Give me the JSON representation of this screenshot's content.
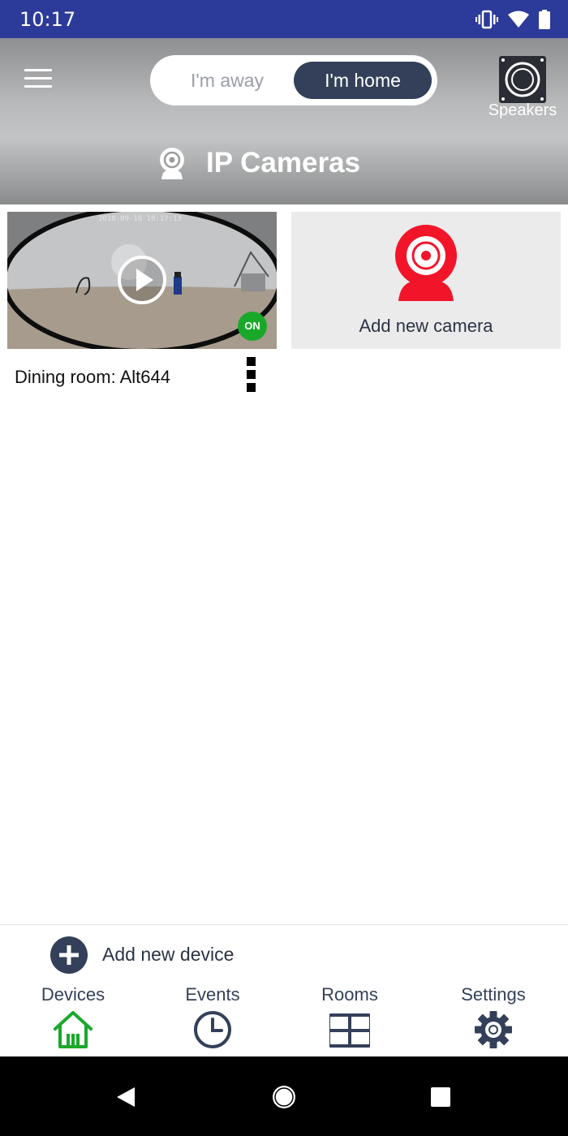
{
  "status_bar": {
    "time": "10:17",
    "icons": [
      "vibrate-icon",
      "wifi-icon",
      "battery-icon"
    ],
    "background": "#2c3a9a"
  },
  "header": {
    "mode_toggle": {
      "away_label": "I'm away",
      "home_label": "I'm home",
      "selected": "home"
    },
    "speakers_label": "Speakers",
    "title": "IP Cameras"
  },
  "cameras": [
    {
      "name": "Dining room: Alt644",
      "timestamp": "2018-09-16 10:17:13",
      "status": "ON"
    }
  ],
  "add_camera": {
    "label": "Add new camera",
    "icon": "webcam-icon",
    "accent": "#f2152a"
  },
  "add_device": {
    "label": "Add new device"
  },
  "bottom_nav": [
    {
      "label": "Devices",
      "icon": "home-icon",
      "active": true
    },
    {
      "label": "Events",
      "icon": "clock-icon",
      "active": false
    },
    {
      "label": "Rooms",
      "icon": "grid-icon",
      "active": false
    },
    {
      "label": "Settings",
      "icon": "gear-icon",
      "active": false
    }
  ],
  "colors": {
    "primary": "#344059",
    "active_nav": "#1aa82b",
    "on_badge": "#1aa82b"
  }
}
